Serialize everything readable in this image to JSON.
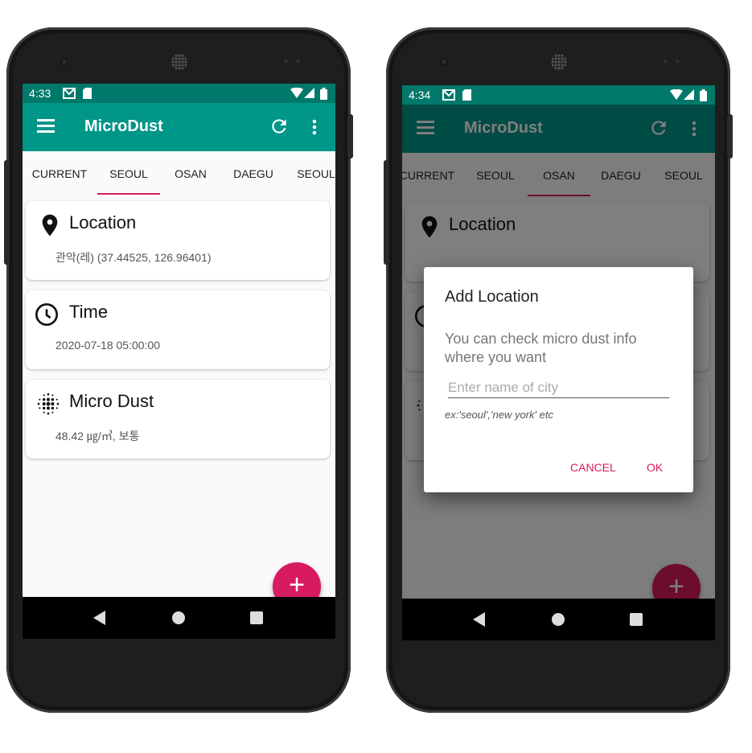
{
  "left_phone": {
    "status_time": "4:33",
    "app_title": "MicroDust",
    "tabs": [
      "CURRENT",
      "SEOUL",
      "OSAN",
      "DAEGU",
      "SEOUL"
    ],
    "cards": {
      "location": {
        "title": "Location",
        "value": "관악(레) (37.44525, 126.96401)",
        "icon": "location-pin-icon"
      },
      "time": {
        "title": "Time",
        "value": "2020-07-18 05:00:00",
        "icon": "clock-icon"
      },
      "dust": {
        "title": "Micro Dust",
        "value": "48.42 ㎍/㎥, 보통",
        "icon": "dots-icon"
      }
    },
    "fab": "+"
  },
  "right_phone": {
    "status_time": "4:34",
    "app_title": "MicroDust",
    "tabs": [
      "CURRENT",
      "SEOUL",
      "OSAN",
      "DAEGU",
      "SEOUL"
    ],
    "location_title": "Location",
    "fab": "+",
    "dialog": {
      "title": "Add Location",
      "message": "You can check micro dust info where you want",
      "input_placeholder": "Enter name of city",
      "hint": "ex:'seoul','new york' etc",
      "cancel": "CANCEL",
      "ok": "OK"
    }
  },
  "colors": {
    "primary": "#009688",
    "primary_dark": "#00796b",
    "accent": "#d81b60"
  }
}
